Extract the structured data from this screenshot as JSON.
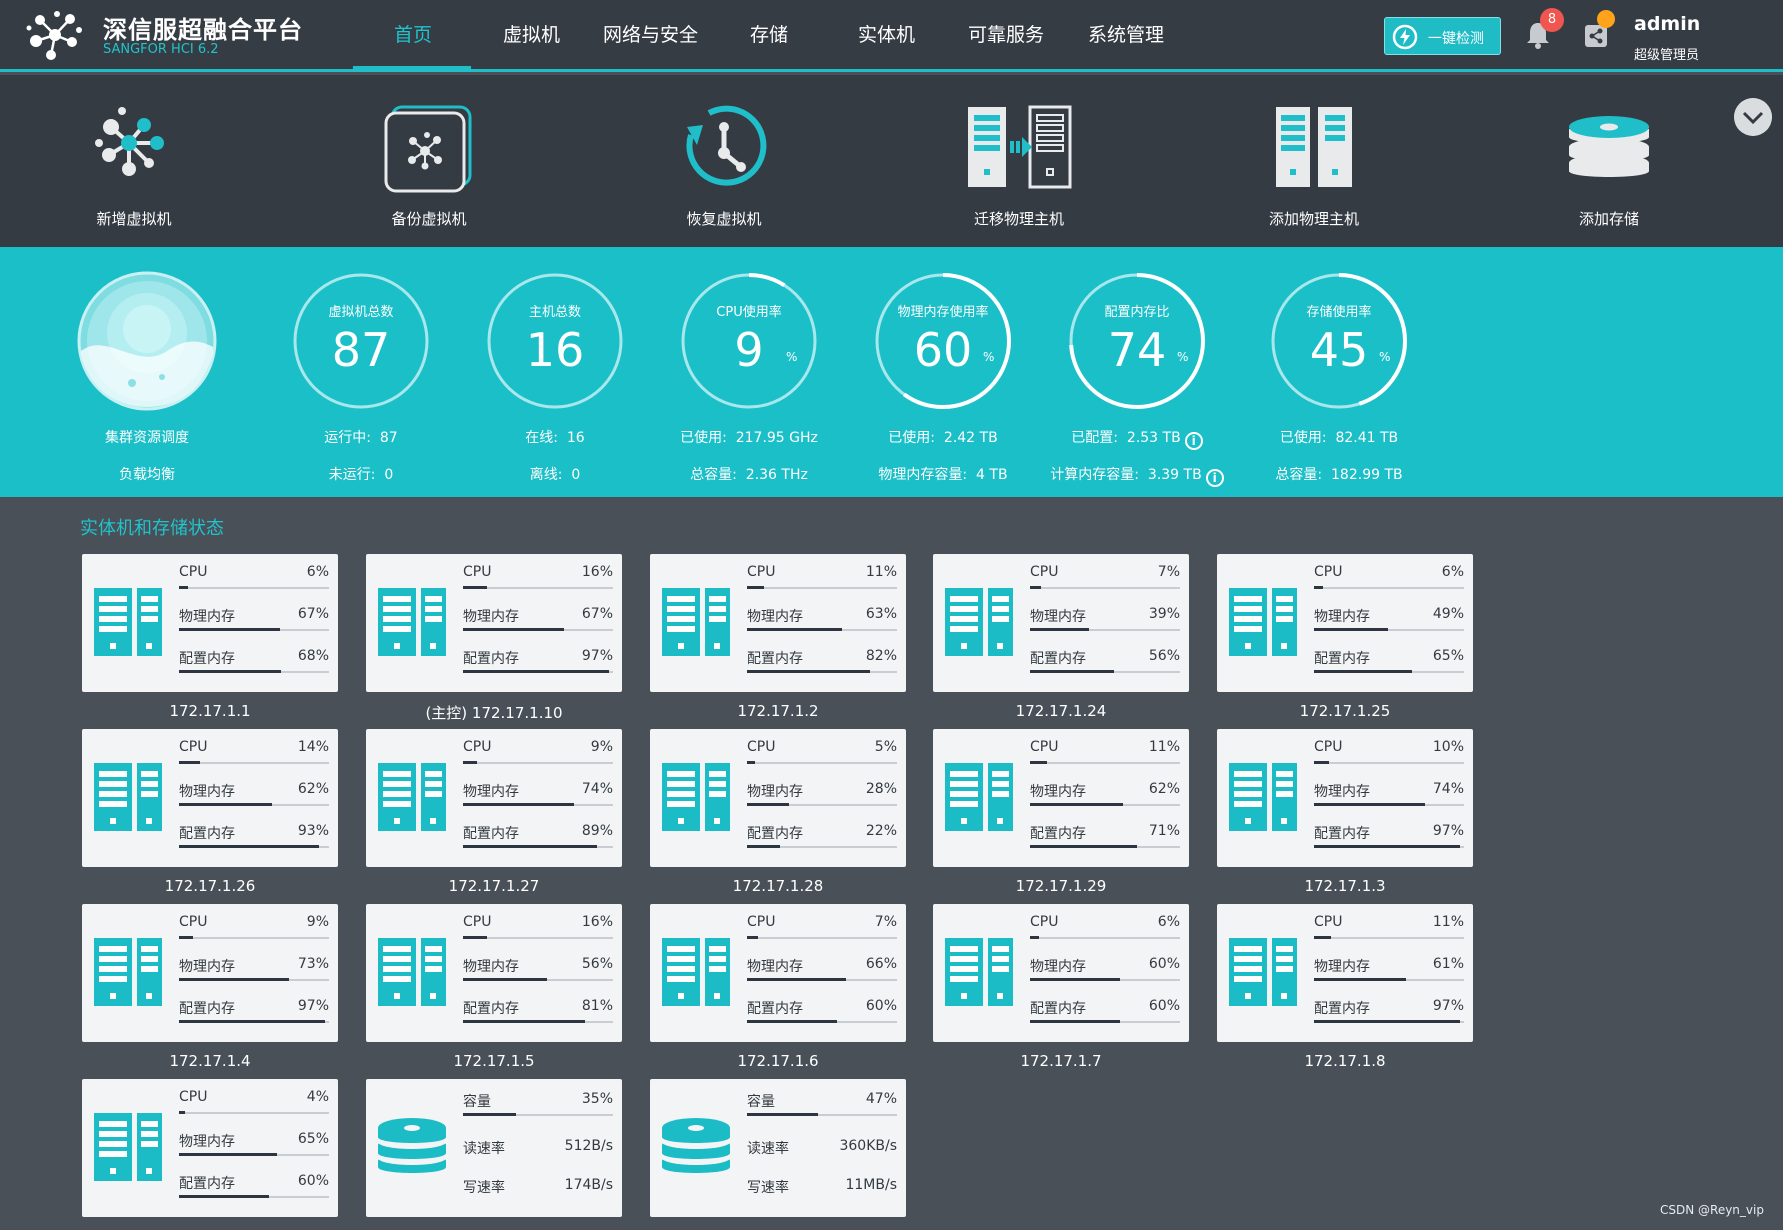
{
  "brand": {
    "title": "深信服超融合平台",
    "subtitle": "SANGFOR HCI 6.2"
  },
  "nav": [
    {
      "label": "首页",
      "active": true
    },
    {
      "label": "虚拟机"
    },
    {
      "label": "网络与安全"
    },
    {
      "label": "存储"
    },
    {
      "label": "实体机"
    },
    {
      "label": "可靠服务"
    },
    {
      "label": "系统管理"
    }
  ],
  "header": {
    "check_label": "一键检测",
    "notification_count": "8",
    "user_name": "admin",
    "user_role": "超级管理员"
  },
  "actions": [
    {
      "label": "新增虚拟机",
      "icon": "network-nodes-icon"
    },
    {
      "label": "备份虚拟机",
      "icon": "backup-icon"
    },
    {
      "label": "恢复虚拟机",
      "icon": "restore-clock-icon"
    },
    {
      "label": "迁移物理主机",
      "icon": "migrate-server-icon"
    },
    {
      "label": "添加物理主机",
      "icon": "add-server-icon"
    },
    {
      "label": "添加存储",
      "icon": "storage-disk-icon"
    }
  ],
  "stats": {
    "cluster": {
      "line1": "集群资源调度",
      "line2": "负载均衡"
    },
    "vm": {
      "title": "虚拟机总数",
      "value": "87",
      "line1_label": "运行中:",
      "line1_value": "87",
      "line2_label": "未运行:",
      "line2_value": "0"
    },
    "host": {
      "title": "主机总数",
      "value": "16",
      "line1_label": "在线:",
      "line1_value": "16",
      "line2_label": "离线:",
      "line2_value": "0"
    },
    "cpu": {
      "title": "CPU使用率",
      "value": "9",
      "unit": "%",
      "ratio": 0.09,
      "line1_label": "已使用:",
      "line1_value": "217.95 GHz",
      "line2_label": "总容量:",
      "line2_value": "2.36 THz"
    },
    "mem": {
      "title": "物理内存使用率",
      "value": "60",
      "unit": "%",
      "ratio": 0.6,
      "line1_label": "已使用:",
      "line1_value": "2.42 TB",
      "line2_label": "物理内存容量:",
      "line2_value": "4 TB"
    },
    "cfgmem": {
      "title": "配置内存比",
      "value": "74",
      "unit": "%",
      "ratio": 0.74,
      "line1_label": "已配置:",
      "line1_value": "2.53 TB",
      "line2_label": "计算内存容量:",
      "line2_value": "3.39 TB"
    },
    "storage": {
      "title": "存储使用率",
      "value": "45",
      "unit": "%",
      "ratio": 0.45,
      "line1_label": "已使用:",
      "line1_value": "82.41 TB",
      "line2_label": "总容量:",
      "line2_value": "182.99 TB"
    }
  },
  "section_title": "实体机和存储状态",
  "metric_labels": {
    "cpu": "CPU",
    "mem": "物理内存",
    "cfg": "配置内存"
  },
  "hosts": [
    {
      "ip": "172.17.1.1",
      "cpu": "6%",
      "mem": "67%",
      "cfg": "68%"
    },
    {
      "ip": "(主控) 172.17.1.10",
      "cpu": "16%",
      "mem": "67%",
      "cfg": "97%"
    },
    {
      "ip": "172.17.1.2",
      "cpu": "11%",
      "mem": "63%",
      "cfg": "82%"
    },
    {
      "ip": "172.17.1.24",
      "cpu": "7%",
      "mem": "39%",
      "cfg": "56%"
    },
    {
      "ip": "172.17.1.25",
      "cpu": "6%",
      "mem": "49%",
      "cfg": "65%"
    },
    {
      "ip": "172.17.1.26",
      "cpu": "14%",
      "mem": "62%",
      "cfg": "93%"
    },
    {
      "ip": "172.17.1.27",
      "cpu": "9%",
      "mem": "74%",
      "cfg": "89%"
    },
    {
      "ip": "172.17.1.28",
      "cpu": "5%",
      "mem": "28%",
      "cfg": "22%"
    },
    {
      "ip": "172.17.1.29",
      "cpu": "11%",
      "mem": "62%",
      "cfg": "71%"
    },
    {
      "ip": "172.17.1.3",
      "cpu": "10%",
      "mem": "74%",
      "cfg": "97%"
    },
    {
      "ip": "172.17.1.4",
      "cpu": "9%",
      "mem": "73%",
      "cfg": "97%"
    },
    {
      "ip": "172.17.1.5",
      "cpu": "16%",
      "mem": "56%",
      "cfg": "81%"
    },
    {
      "ip": "172.17.1.6",
      "cpu": "7%",
      "mem": "66%",
      "cfg": "60%"
    },
    {
      "ip": "172.17.1.7",
      "cpu": "6%",
      "mem": "60%",
      "cfg": "60%"
    },
    {
      "ip": "172.17.1.8",
      "cpu": "11%",
      "mem": "61%",
      "cfg": "97%"
    },
    {
      "ip": "",
      "cpu": "4%",
      "mem": "65%",
      "cfg": "60%"
    }
  ],
  "storages": [
    {
      "cap_label": "容量",
      "cap": "35%",
      "read_label": "读速率",
      "read": "512B/s",
      "write_label": "写速率",
      "write": "174B/s"
    },
    {
      "cap_label": "容量",
      "cap": "47%",
      "read_label": "读速率",
      "read": "360KB/s",
      "write_label": "写速率",
      "write": "11MB/s"
    }
  ],
  "watermark": "CSDN @Reyn_vip",
  "colors": {
    "accent": "#1fbec8",
    "header_bg": "#363c44",
    "page_bg": "#4a5058",
    "badge_red": "#f0554f",
    "badge_orange": "#ffa31a"
  }
}
